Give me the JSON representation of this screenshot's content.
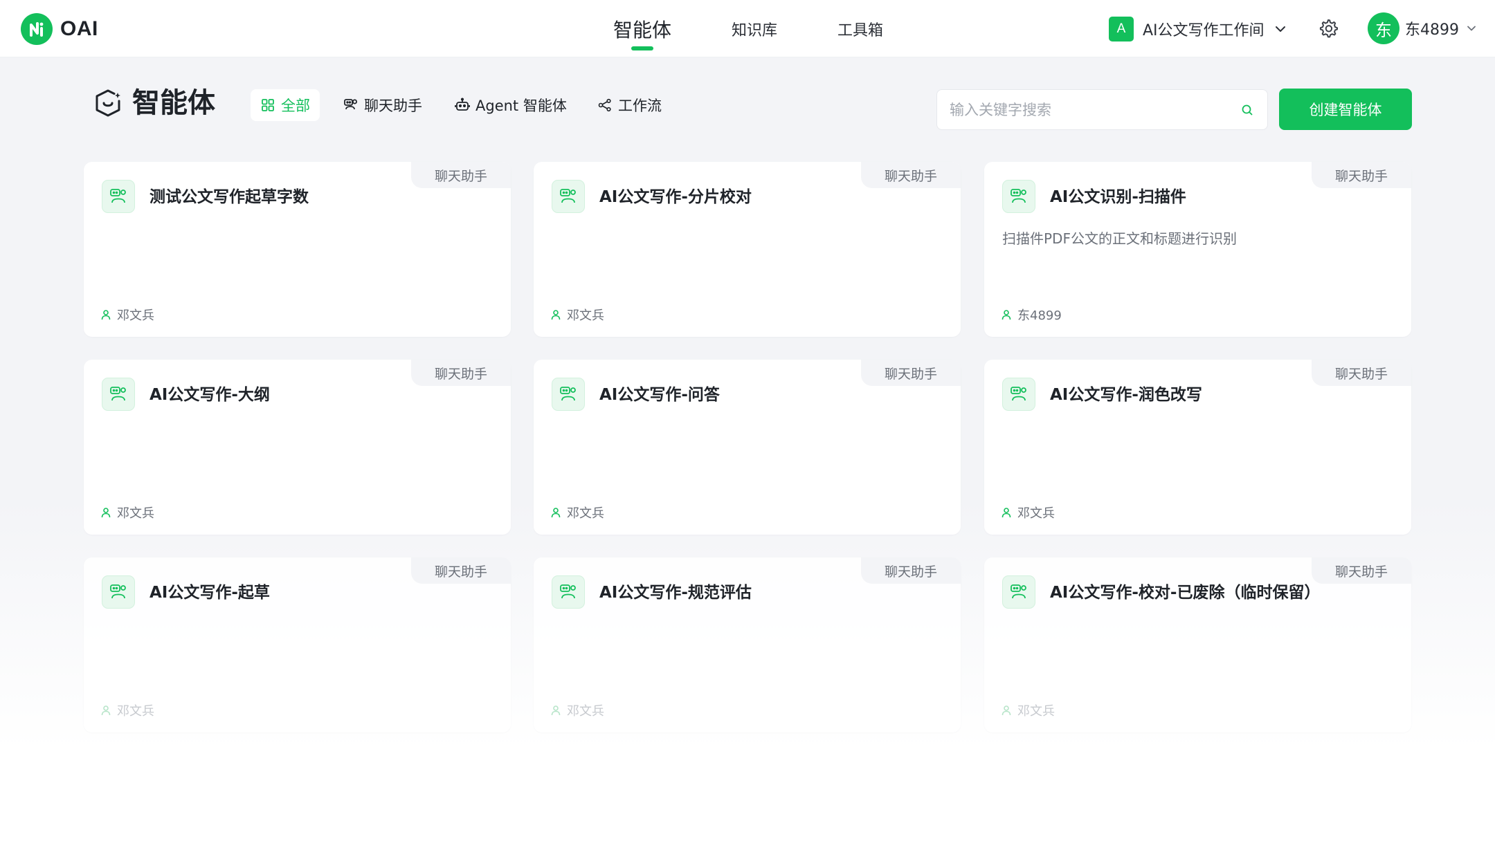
{
  "brand": {
    "name": "OAI"
  },
  "nav": {
    "items": [
      {
        "label": "智能体",
        "active": true
      },
      {
        "label": "知识库",
        "active": false
      },
      {
        "label": "工具箱",
        "active": false
      }
    ]
  },
  "workspace": {
    "badge": "A",
    "name": "AI公文写作工作间"
  },
  "user": {
    "avatar_text": "东",
    "name": "东4899"
  },
  "page": {
    "title": "智能体",
    "filters": [
      {
        "label": "全部",
        "icon": "grid-icon",
        "active": true
      },
      {
        "label": "聊天助手",
        "icon": "chat-bot-icon",
        "active": false
      },
      {
        "label": "Agent 智能体",
        "icon": "robot-icon",
        "active": false
      },
      {
        "label": "工作流",
        "icon": "workflow-icon",
        "active": false
      }
    ],
    "search_placeholder": "输入关键字搜索",
    "create_label": "创建智能体"
  },
  "cards": [
    {
      "type": "聊天助手",
      "title": "测试公文写作起草字数",
      "desc": "",
      "author": "邓文兵"
    },
    {
      "type": "聊天助手",
      "title": "AI公文写作-分片校对",
      "desc": "",
      "author": "邓文兵"
    },
    {
      "type": "聊天助手",
      "title": "AI公文识别-扫描件",
      "desc": "扫描件PDF公文的正文和标题进行识别",
      "author": "东4899"
    },
    {
      "type": "聊天助手",
      "title": "AI公文写作-大纲",
      "desc": "",
      "author": "邓文兵"
    },
    {
      "type": "聊天助手",
      "title": "AI公文写作-问答",
      "desc": "",
      "author": "邓文兵"
    },
    {
      "type": "聊天助手",
      "title": "AI公文写作-润色改写",
      "desc": "",
      "author": "邓文兵"
    },
    {
      "type": "聊天助手",
      "title": "AI公文写作-起草",
      "desc": "",
      "author": "邓文兵"
    },
    {
      "type": "聊天助手",
      "title": "AI公文写作-规范评估",
      "desc": "",
      "author": "邓文兵"
    },
    {
      "type": "聊天助手",
      "title": "AI公文写作-校对-已废除（临时保留）",
      "desc": "",
      "author": "邓文兵"
    }
  ],
  "colors": {
    "accent": "#13bf5b",
    "background": "#f3f4f7",
    "text": "#1f2329",
    "muted_text": "#6b7079"
  }
}
